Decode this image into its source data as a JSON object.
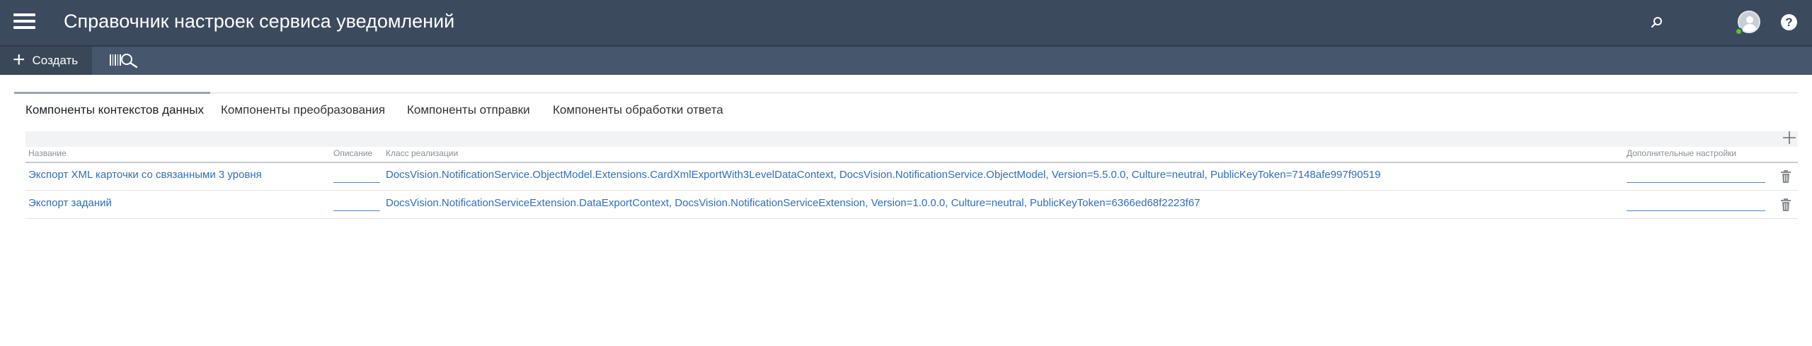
{
  "header": {
    "title": "Справочник настроек сервиса уведомлений",
    "menu_icon": "hamburger-icon",
    "search_icon": "search-icon",
    "avatar_icon": "user-avatar",
    "status_color": "#5bc236",
    "help_label": "?"
  },
  "toolbar": {
    "create_label": "Создать",
    "create_icon": "plus-icon",
    "barcode_icon": "barcode-search-icon"
  },
  "tabs": [
    {
      "label": "Компоненты контекстов данных",
      "active": true
    },
    {
      "label": "Компоненты преобразования",
      "active": false
    },
    {
      "label": "Компоненты отправки",
      "active": false
    },
    {
      "label": "Компоненты обработки ответа",
      "active": false
    }
  ],
  "table": {
    "columns": [
      "Название",
      "Описание",
      "Класс реализации",
      "Дополнительные настройки"
    ],
    "rows": [
      {
        "name": "Экспорт XML карточки со связанными 3 уровня",
        "description": "",
        "class": "DocsVision.NotificationService.ObjectModel.Extensions.CardXmlExportWith3LevelDataContext, DocsVision.NotificationService.ObjectModel, Version=5.5.0.0, Culture=neutral, PublicKeyToken=7148afe997f90519",
        "settings": ""
      },
      {
        "name": "Экспорт заданий",
        "description": "",
        "class": "DocsVision.NotificationServiceExtension.DataExportContext, DocsVision.NotificationServiceExtension, Version=1.0.0.0, Culture=neutral, PublicKeyToken=6366ed68f2223f67",
        "settings": ""
      }
    ]
  },
  "colors": {
    "header_bg": "#3c4a5e",
    "toolbar_bg": "#46566d",
    "link": "#2f6fba"
  }
}
